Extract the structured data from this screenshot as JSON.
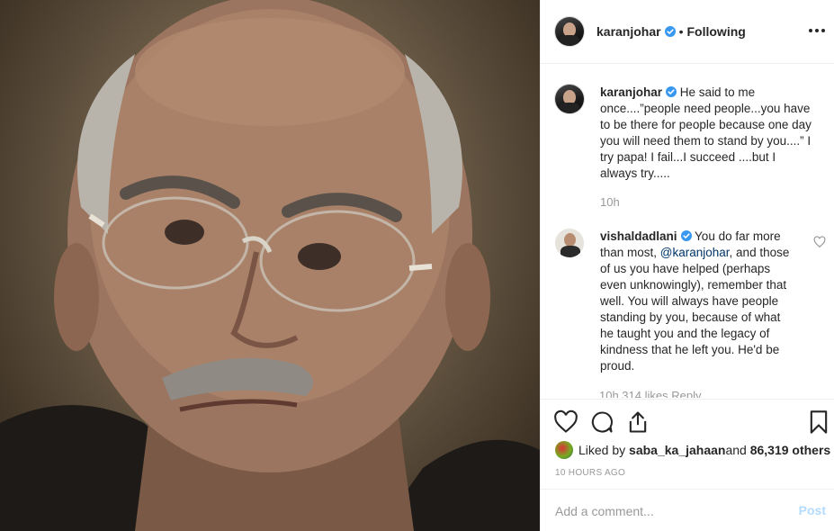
{
  "photo": {
    "icon": "portrait-photo"
  },
  "header": {
    "username": "karanjohar",
    "separator": "•",
    "follow_status": "Following"
  },
  "caption": {
    "username": "karanjohar",
    "text": "He said to me once....”people need people...you have to be there for people because one day you will need them to stand by you....” I try papa! I fail...I succeed ....but I always try.....",
    "time": "10h"
  },
  "comment": {
    "username": "vishaldadlani",
    "text_before": "You do far more than most, ",
    "mention": "@karanjohar",
    "text_after": ", and those of us you have helped (perhaps even unknowingly), remember that well. You will always have people standing by you, because of what he taught you and the legacy of kindness that he left you. He'd be proud.",
    "meta_clipped": "10h   314 likes   Reply"
  },
  "likes": {
    "prefix": "Liked by ",
    "user": "saba_ka_jahaan",
    "middle": " and ",
    "count": "86,319 others"
  },
  "timestamp": "10 HOURS AGO",
  "add_comment": {
    "placeholder": "Add a comment...",
    "post_label": "Post"
  },
  "colors": {
    "verified": "#3897f0",
    "post_disabled": "#b3dbff",
    "muted": "#999999"
  }
}
